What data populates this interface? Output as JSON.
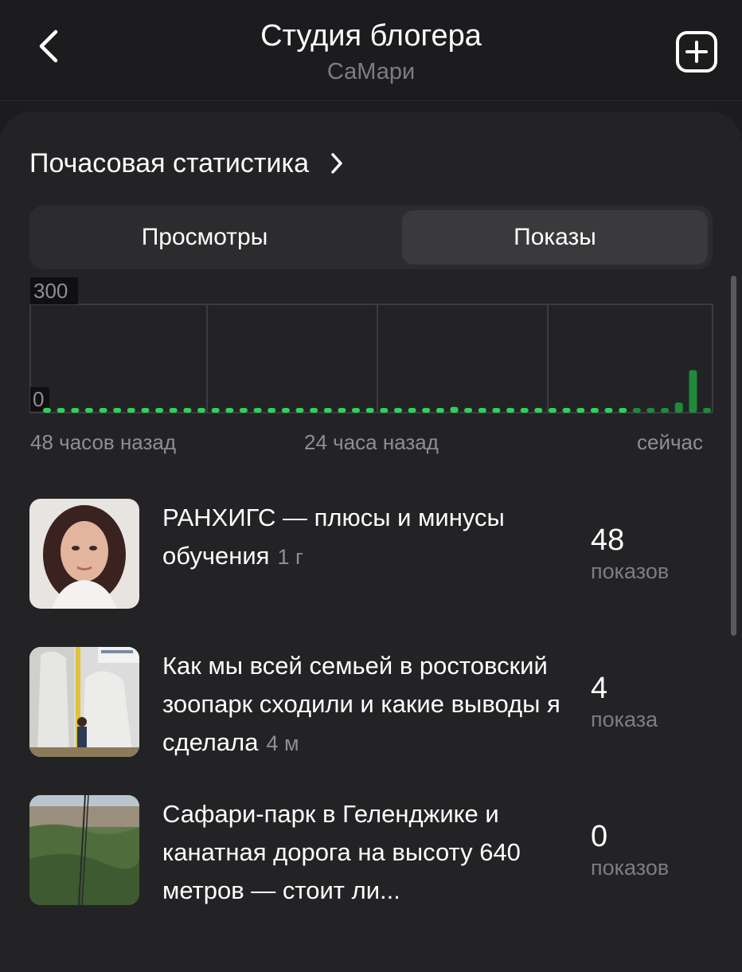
{
  "header": {
    "title": "Студия блогера",
    "subtitle": "СаМари"
  },
  "section": {
    "title": "Почасовая статистика"
  },
  "tabs": [
    {
      "label": "Просмотры",
      "selected": false
    },
    {
      "label": "Показы",
      "selected": true
    }
  ],
  "chart_data": {
    "type": "bar",
    "ylabels": [
      "300",
      "0"
    ],
    "ylim": [
      0,
      300
    ],
    "xlabels": [
      "48 часов назад",
      "24 часа назад",
      "сейчас"
    ],
    "grid": true,
    "colors": {
      "bar": "#30d158",
      "bar_fading": "#1f8a3c"
    },
    "values": [
      3,
      3,
      3,
      3,
      3,
      3,
      3,
      3,
      3,
      3,
      3,
      3,
      3,
      3,
      3,
      3,
      3,
      5,
      4,
      3,
      3,
      3,
      3,
      3,
      3,
      5,
      10,
      5,
      5,
      16,
      12,
      5,
      5,
      11,
      12,
      5,
      3,
      3,
      3,
      3,
      3,
      3,
      3,
      3,
      5,
      28,
      118,
      3
    ]
  },
  "articles": [
    {
      "title": "РАНХИГС — плюсы и минусы обучения",
      "age": "1 г",
      "count": "48",
      "count_label": "показов"
    },
    {
      "title": "Как мы всей семьей в ростовский зоопарк сходили и какие выводы я сделала",
      "age": "4 м",
      "count": "4",
      "count_label": "показа"
    },
    {
      "title": "Сафари-парк в Геленджике и канатная дорога на высоту 640 метров — стоит ли...",
      "age": "",
      "count": "0",
      "count_label": "показов"
    }
  ]
}
